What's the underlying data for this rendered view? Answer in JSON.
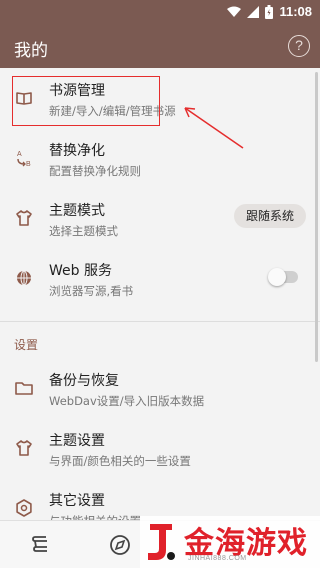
{
  "status_bar": {
    "time": "11:08",
    "wifi_icon": "wifi-icon",
    "signal_icon": "signal-icon",
    "battery_icon": "battery-icon"
  },
  "app_bar": {
    "title": "我的",
    "help_glyph": "?"
  },
  "items": [
    {
      "title": "书源管理",
      "subtitle": "新建/导入/编辑/管理书源",
      "icon": "book-icon"
    },
    {
      "title": "替换净化",
      "subtitle": "配置替换净化规则",
      "icon": "replace-icon"
    },
    {
      "title": "主题模式",
      "subtitle": "选择主题模式",
      "icon": "shirt-icon",
      "button": "跟随系统"
    },
    {
      "title": "Web 服务",
      "subtitle": "浏览器写源,看书",
      "icon": "globe-icon",
      "toggle_on": false
    }
  ],
  "section_title": "设置",
  "settings": [
    {
      "title": "备份与恢复",
      "subtitle": "WebDav设置/导入旧版本数据",
      "icon": "folder-icon"
    },
    {
      "title": "主题设置",
      "subtitle": "与界面/颜色相关的一些设置",
      "icon": "shirt-icon"
    },
    {
      "title": "其它设置",
      "subtitle": "与功能相关的设置",
      "icon": "gear-icon"
    }
  ],
  "bottom_nav": [
    "bookshelf-icon",
    "discover-icon"
  ],
  "watermark": {
    "text": "金海游戏",
    "url": "JINHAI888.COM"
  },
  "colors": {
    "primary": "#7b5a52",
    "accent": "#8e5a4a",
    "annotation": "#e52d2d",
    "watermark": "#e0212a"
  }
}
